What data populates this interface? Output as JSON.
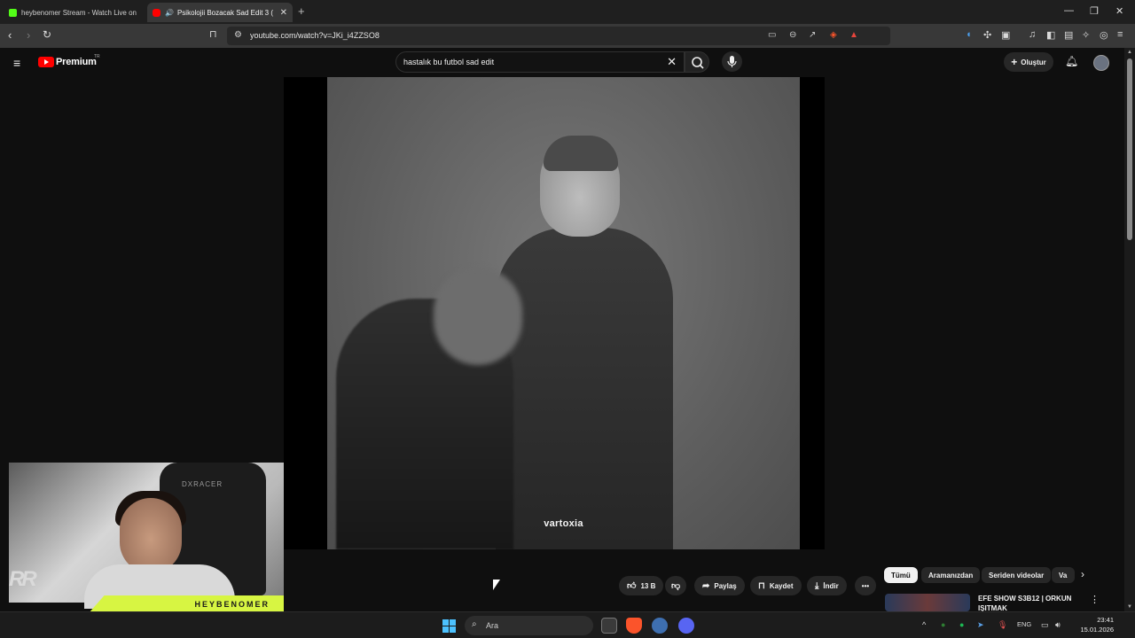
{
  "browser": {
    "tabs": [
      {
        "label": "heybenomer Stream - Watch Live on",
        "favicon_color": "#53fc18"
      },
      {
        "label": "Psikolojii Bozacak Sad Edit 3 (",
        "favicon_color": "#ff0000"
      }
    ],
    "url": "youtube.com/watch?v=JKi_i4ZZSO8"
  },
  "youtube": {
    "brand": "Premium",
    "region": "TR",
    "search": {
      "query": "hastalık bu futbol sad edit"
    },
    "create_label": "Oluştur"
  },
  "video": {
    "watermark": "vartoxia"
  },
  "actions": {
    "like_count": "13 B",
    "share_label": "Paylaş",
    "save_label": "Kaydet",
    "download_label": "İndir"
  },
  "chips": [
    "Tümü",
    "Aramanızdan",
    "Seriden videolar",
    "Va"
  ],
  "recommendation": {
    "title": "EFE SHOW S3B12 | ORKUN IŞITMAK"
  },
  "overlay": {
    "streamer_name": "HEYBENOMER",
    "chair_brand": "DXRACER",
    "logo": "RR"
  },
  "taskbar": {
    "search_placeholder": "Ara",
    "language": "ENG",
    "time": "23:41",
    "date": "15.01.2026"
  },
  "colors": {
    "youtube_red": "#ff0000",
    "kick_green": "#53fc18",
    "overlay_lime": "#d7f542"
  }
}
